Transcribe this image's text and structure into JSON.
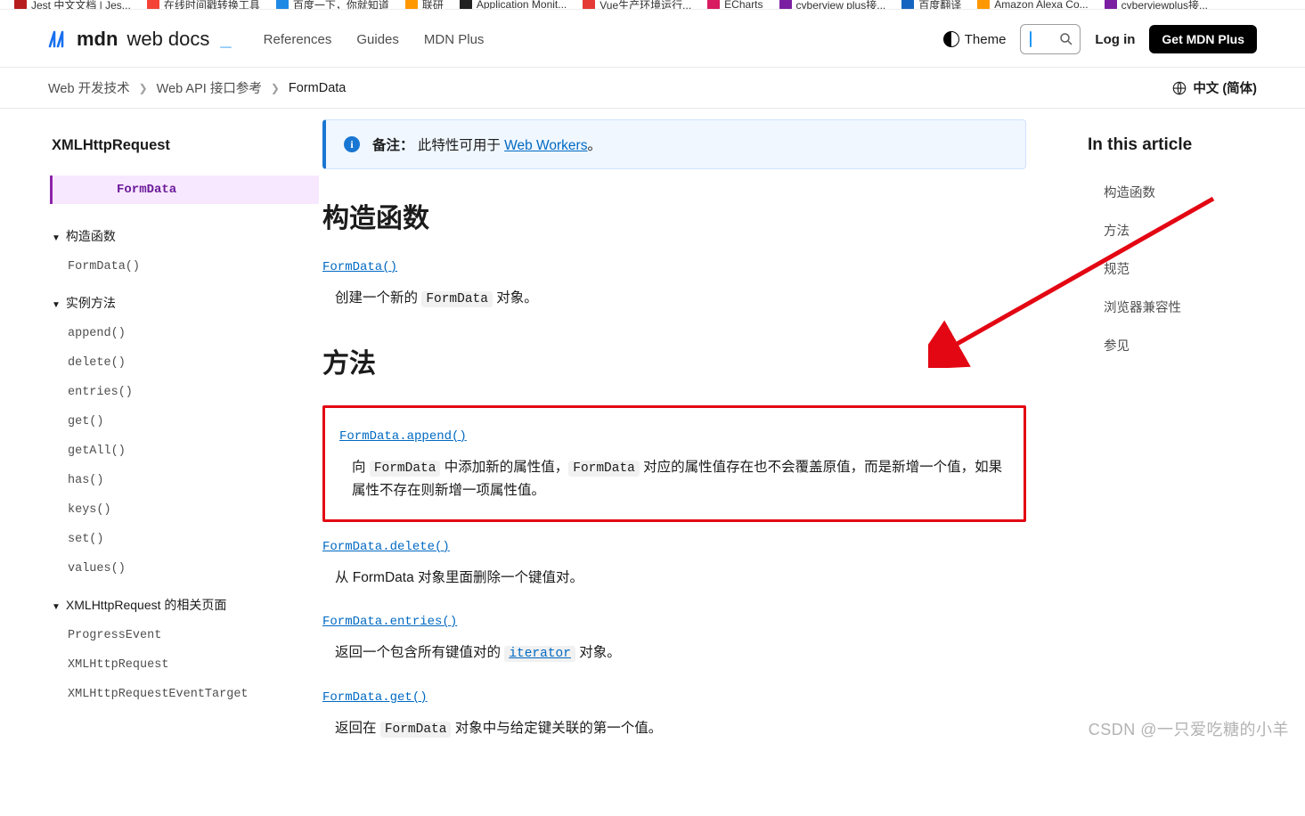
{
  "bookmarks": [
    {
      "label": "Jest 中文文档 | Jes...",
      "color": "#b71c1c"
    },
    {
      "label": "在线时间戳转换工具",
      "color": "#f44336"
    },
    {
      "label": "百度一下，你就知道",
      "color": "#1e88e5"
    },
    {
      "label": "联研",
      "color": "#ff9800"
    },
    {
      "label": "Application Monit...",
      "color": "#212121"
    },
    {
      "label": "Vue生产环境运行...",
      "color": "#e53935"
    },
    {
      "label": "ECharts",
      "color": "#d81b60"
    },
    {
      "label": "cyberview plus接...",
      "color": "#7b1fa2"
    },
    {
      "label": "百度翻译",
      "color": "#1565c0"
    },
    {
      "label": "Amazon Alexa Co...",
      "color": "#ff9800"
    },
    {
      "label": "cyberviewplus接...",
      "color": "#7b1fa2"
    }
  ],
  "header": {
    "logo_main": "mdn",
    "logo_sub": "web docs",
    "nav": [
      "References",
      "Guides",
      "MDN Plus"
    ],
    "theme_label": "Theme",
    "login_label": "Log in",
    "getplus_label": "Get MDN Plus"
  },
  "breadcrumb": {
    "items": [
      "Web 开发技术",
      "Web API 接口参考",
      "FormData"
    ],
    "lang_label": "中文 (简体)"
  },
  "sidebar": {
    "heading": "XMLHttpRequest",
    "active": "FormData",
    "groups": [
      {
        "title": "构造函数",
        "items": [
          "FormData()"
        ]
      },
      {
        "title": "实例方法",
        "items": [
          "append()",
          "delete()",
          "entries()",
          "get()",
          "getAll()",
          "has()",
          "keys()",
          "set()",
          "values()"
        ]
      },
      {
        "title": "XMLHttpRequest 的相关页面",
        "items": [
          "ProgressEvent",
          "XMLHttpRequest",
          "XMLHttpRequestEventTarget"
        ]
      }
    ]
  },
  "main": {
    "note_prefix": "备注：",
    "note_text_before": "此特性可用于 ",
    "note_link": "Web Workers",
    "note_text_after": "。",
    "h_constructor": "构造函数",
    "constr_term": "FormData()",
    "constr_desc_before": "创建一个新的 ",
    "constr_desc_after": " 对象。",
    "h_methods": "方法",
    "methods": [
      {
        "term": "FormData.append()",
        "desc_before": "向 ",
        "desc_mid1": " 中添加新的属性值，",
        "desc_mid2": " 对应的属性值存在也不会覆盖原值，而是新增一个值，如果属性不存在则新增一项属性值。"
      },
      {
        "term": "FormData.delete()",
        "desc_plain": "从 FormData 对象里面删除一个键值对。"
      },
      {
        "term": "FormData.entries()",
        "desc_before": "返回一个包含所有键值对的 ",
        "desc_link": "iterator",
        "desc_after": " 对象。"
      },
      {
        "term": "FormData.get()",
        "desc_before": "返回在 ",
        "desc_after": " 对象中与给定键关联的第一个值。"
      }
    ]
  },
  "toc": {
    "heading": "In this article",
    "items": [
      "构造函数",
      "方法",
      "规范",
      "浏览器兼容性",
      "参见"
    ]
  },
  "code_token": "FormData",
  "watermark": "CSDN @一只爱吃糖的小羊"
}
